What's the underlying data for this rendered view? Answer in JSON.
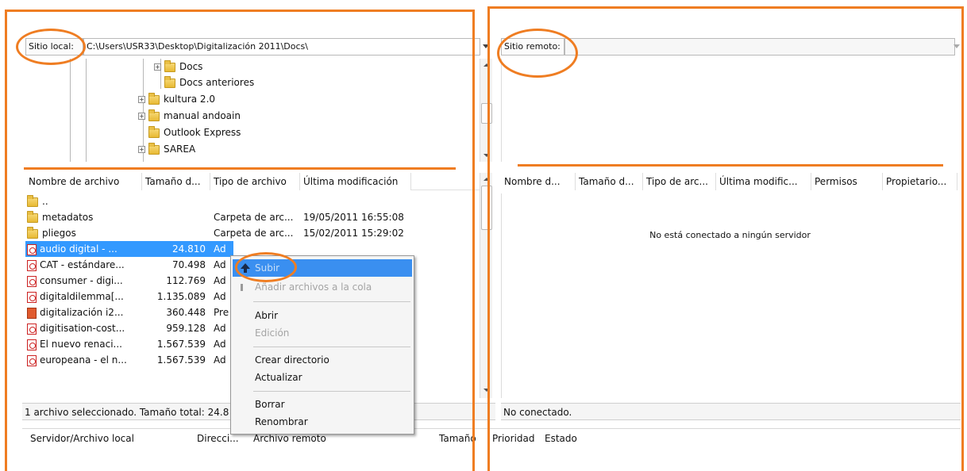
{
  "local": {
    "path_label": "Sitio local:",
    "path_value": "C:\\Users\\USR33\\Desktop\\Digitalización 2011\\Docs\\",
    "tree": [
      {
        "label": "Docs",
        "expander": "+"
      },
      {
        "label": "Docs anteriores",
        "expander": ""
      },
      {
        "label": "kultura 2.0",
        "expander": "+"
      },
      {
        "label": "manual andoain",
        "expander": "+"
      },
      {
        "label": "Outlook Express",
        "expander": ""
      },
      {
        "label": "SAREA",
        "expander": "+"
      }
    ],
    "columns": [
      "Nombre de archivo",
      "Tamaño d...",
      "Tipo de archivo",
      "Última modificación"
    ],
    "files": [
      {
        "name": "..",
        "size": "",
        "type": "",
        "date": "",
        "icon": "folder-icon"
      },
      {
        "name": "metadatos",
        "size": "",
        "type": "Carpeta de arc...",
        "date": "19/05/2011 16:55:08",
        "icon": "folder-icon"
      },
      {
        "name": "pliegos",
        "size": "",
        "type": "Carpeta de arc...",
        "date": "15/02/2011 15:29:02",
        "icon": "folder-icon"
      },
      {
        "name": "audio digital - ...",
        "size": "24.810",
        "type": "Ad",
        "date": "",
        "icon": "pdf-icon"
      },
      {
        "name": "CAT - estándare...",
        "size": "70.498",
        "type": "Ad",
        "date": "",
        "icon": "pdf-icon"
      },
      {
        "name": "consumer - digi...",
        "size": "112.769",
        "type": "Ad",
        "date": "",
        "icon": "pdf-icon"
      },
      {
        "name": "digitaldilemma[...",
        "size": "1.135.089",
        "type": "Ad",
        "date": "",
        "icon": "pdf-icon"
      },
      {
        "name": "digitalización i2...",
        "size": "360.448",
        "type": "Pre",
        "date": "",
        "icon": "presentation-icon"
      },
      {
        "name": "digitisation-cost...",
        "size": "959.128",
        "type": "Ad",
        "date": "",
        "icon": "pdf-icon"
      },
      {
        "name": "El nuevo renaci...",
        "size": "1.567.539",
        "type": "Ad",
        "date": "",
        "icon": "pdf-icon"
      },
      {
        "name": "europeana - el n...",
        "size": "1.567.539",
        "type": "Ad",
        "date": "",
        "icon": "pdf-icon"
      }
    ],
    "status": "1 archivo seleccionado. Tamaño total: 24.8"
  },
  "remote": {
    "path_label": "Sitio remoto:",
    "path_value": "",
    "columns": [
      "Nombre d...",
      "Tamaño d...",
      "Tipo de arc...",
      "Última modific...",
      "Permisos",
      "Propietario..."
    ],
    "empty_message": "No está conectado a ningún servidor",
    "status": "No conectado."
  },
  "context_menu": {
    "items": [
      {
        "label": "Subir",
        "state": "highlighted",
        "icon": "upload-arrow-icon"
      },
      {
        "label": "Añadir archivos a la cola",
        "state": "disabled",
        "icon": "queue-icon"
      },
      {
        "label": "Abrir",
        "state": "normal"
      },
      {
        "label": "Edición",
        "state": "disabled"
      },
      {
        "label": "Crear directorio",
        "state": "normal"
      },
      {
        "label": "Actualizar",
        "state": "normal"
      },
      {
        "label": "Borrar",
        "state": "normal"
      },
      {
        "label": "Renombrar",
        "state": "normal"
      }
    ]
  },
  "queue": {
    "columns": [
      "Servidor/Archivo local",
      "Direcci...",
      "Archivo remoto",
      "Tamaño",
      "Prioridad",
      "Estado"
    ]
  },
  "colors": {
    "annotation": "#ef7d22",
    "selection": "#3399ff",
    "menu_highlight": "#3a8ff0"
  }
}
